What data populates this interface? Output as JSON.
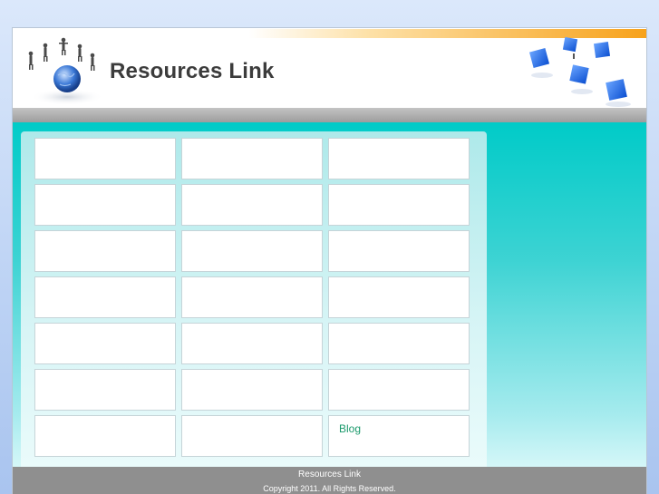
{
  "site": {
    "title": "Resources Link"
  },
  "colors": {
    "accent_orange": "#f7a21b",
    "teal": "#00cbc8",
    "link_green": "#1b9a6c",
    "footer_gray": "#8f8f8f"
  },
  "icons": {
    "header_left": "globe-with-people-icon",
    "header_right": "blue-cubes-icon"
  },
  "grid": {
    "cells": [
      "",
      "",
      "",
      "",
      "",
      "",
      "",
      "",
      "",
      "",
      "",
      "",
      "",
      "",
      "",
      "",
      "",
      "",
      "",
      "",
      "Blog"
    ]
  },
  "footer": {
    "name": "Resources Link",
    "copyright": "Copyright 2011. All Rights Reserved."
  }
}
